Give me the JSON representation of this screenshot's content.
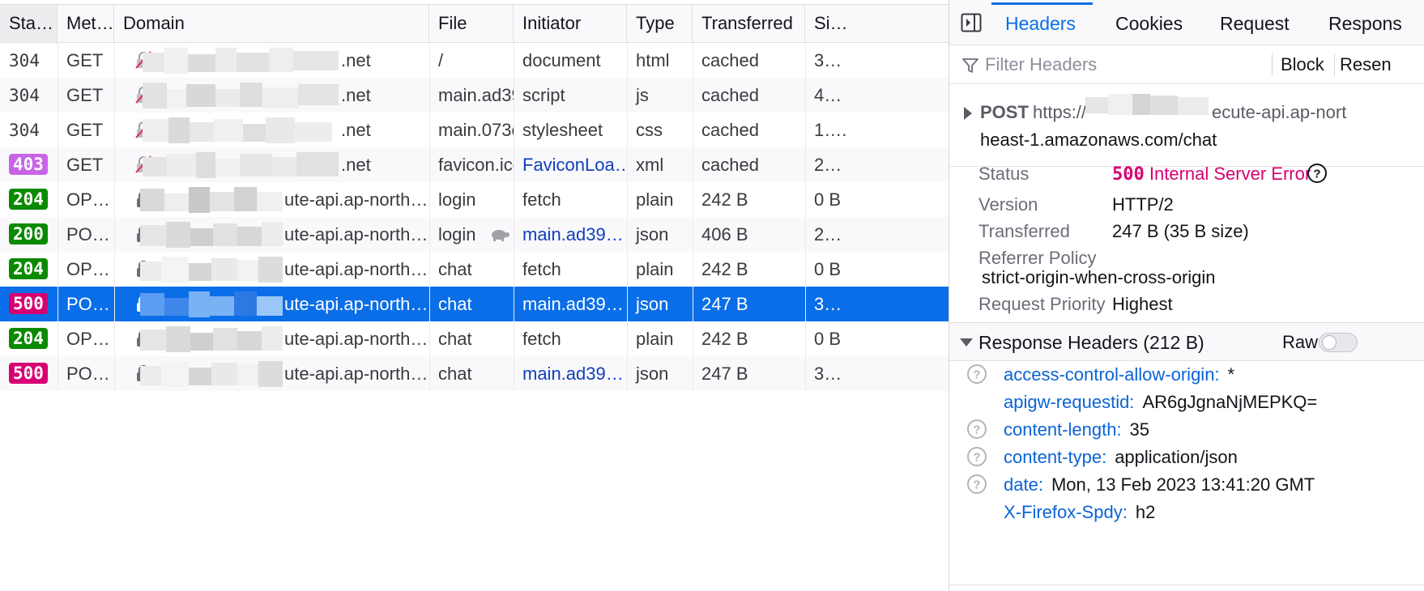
{
  "colors": {
    "accent": "#0a6ee8",
    "status_200_badge": "#0b8a00",
    "status_403_badge": "#c863e8",
    "status_500_badge": "#d70073",
    "selected_row": "#0a6ee8"
  },
  "table": {
    "columns": [
      "Sta…",
      "Met…",
      "Domain",
      "File",
      "Initiator",
      "Type",
      "Transferred",
      "Si…"
    ],
    "rows": [
      {
        "status": "304",
        "method": "GET",
        "domain": ".net",
        "file": "/",
        "initiator": "document",
        "type": "html",
        "transferred": "cached",
        "size": "3…"
      },
      {
        "status": "304",
        "method": "GET",
        "domain": ".net",
        "file": "main.ad39",
        "initiator": "script",
        "type": "js",
        "transferred": "cached",
        "size": "4…"
      },
      {
        "status": "304",
        "method": "GET",
        "domain": ".net",
        "file": "main.073c",
        "initiator": "stylesheet",
        "type": "css",
        "transferred": "cached",
        "size": "1…."
      },
      {
        "status": "403",
        "method": "GET",
        "domain": ".net",
        "file": "favicon.ico",
        "initiator": "FaviconLoa…",
        "type": "xml",
        "transferred": "cached",
        "size": "2…"
      },
      {
        "status": "204",
        "method": "OP…",
        "domain": "ute-api.ap-north…",
        "file": "login",
        "initiator": "fetch",
        "type": "plain",
        "transferred": "242 B",
        "size": "0 B"
      },
      {
        "status": "200",
        "method": "PO…",
        "domain": "ute-api.ap-north…",
        "file": "login",
        "initiator": "main.ad39…",
        "type": "json",
        "transferred": "406 B",
        "size": "2…"
      },
      {
        "status": "204",
        "method": "OP…",
        "domain": "ute-api.ap-north…",
        "file": "chat",
        "initiator": "fetch",
        "type": "plain",
        "transferred": "242 B",
        "size": "0 B"
      },
      {
        "status": "500",
        "method": "PO…",
        "domain": "ute-api.ap-north…",
        "file": "chat",
        "initiator": "main.ad39…",
        "type": "json",
        "transferred": "247 B",
        "size": "3…"
      },
      {
        "status": "204",
        "method": "OP…",
        "domain": "ute-api.ap-north…",
        "file": "chat",
        "initiator": "fetch",
        "type": "plain",
        "transferred": "242 B",
        "size": "0 B"
      },
      {
        "status": "500",
        "method": "PO…",
        "domain": "ute-api.ap-north…",
        "file": "chat",
        "initiator": "main.ad39…",
        "type": "json",
        "transferred": "247 B",
        "size": "3…"
      }
    ]
  },
  "details": {
    "tabs": [
      "Headers",
      "Cookies",
      "Request",
      "Respons"
    ],
    "filter": {
      "placeholder": "Filter Headers",
      "block_label": "Block",
      "resend_label": "Resen"
    },
    "summary": {
      "method": "POST",
      "url_prefix": "https://",
      "url_suffix": "ecute-api.ap-nort",
      "url_line2": "heast-1.amazonaws.com/chat"
    },
    "status_label": "Status",
    "status_code": "500",
    "status_text": "Internal Server Error",
    "version_label": "Version",
    "version_value": "HTTP/2",
    "transferred_label": "Transferred",
    "transferred_value": "247 B (35 B size)",
    "referrer_label": "Referrer Policy",
    "referrer_value": "strict-origin-when-cross-origin",
    "priority_label": "Request Priority",
    "priority_value": "Highest",
    "response_headers_title": "Response Headers (212 B)",
    "raw_label": "Raw",
    "raw_enabled": false,
    "response_headers": [
      {
        "name": "access-control-allow-origin:",
        "value": "*"
      },
      {
        "name": "apigw-requestid:",
        "value": "AR6gJgnaNjMEPKQ="
      },
      {
        "name": "content-length:",
        "value": "35"
      },
      {
        "name": "content-type:",
        "value": "application/json"
      },
      {
        "name": "date:",
        "value": "Mon, 13 Feb 2023 13:41:20 GMT"
      },
      {
        "name": "X-Firefox-Spdy:",
        "value": "h2"
      }
    ]
  }
}
